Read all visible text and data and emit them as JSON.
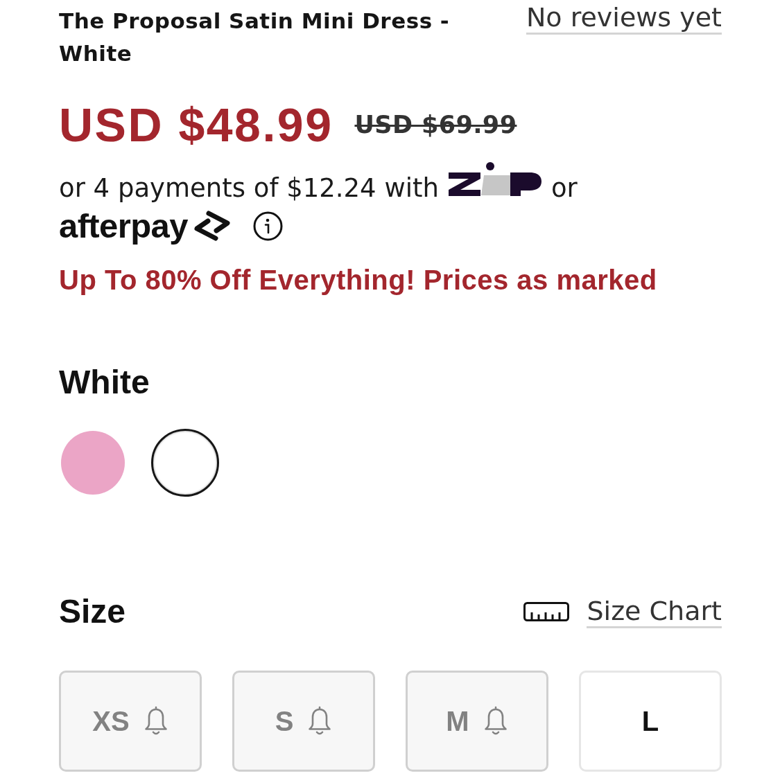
{
  "product": {
    "title": "The Proposal Satin Mini Dress - White",
    "reviews": "No reviews yet"
  },
  "price": {
    "sale": "USD $48.99",
    "original": "USD $69.99"
  },
  "installments": {
    "text": "or 4 payments of $12.24 with",
    "connector": "or",
    "afterpay": "afterpay"
  },
  "promo": "Up To 80% Off Everything! Prices as marked",
  "color": {
    "name": "White",
    "swatches": [
      {
        "color": "#eba5c6",
        "selected": false
      },
      {
        "color": "#ffffff",
        "selected": true
      }
    ]
  },
  "size": {
    "heading": "Size",
    "chart_link": "Size Chart",
    "options": [
      {
        "label": "XS",
        "available": false
      },
      {
        "label": "S",
        "available": false
      },
      {
        "label": "M",
        "available": false
      },
      {
        "label": "L",
        "available": true
      }
    ]
  }
}
